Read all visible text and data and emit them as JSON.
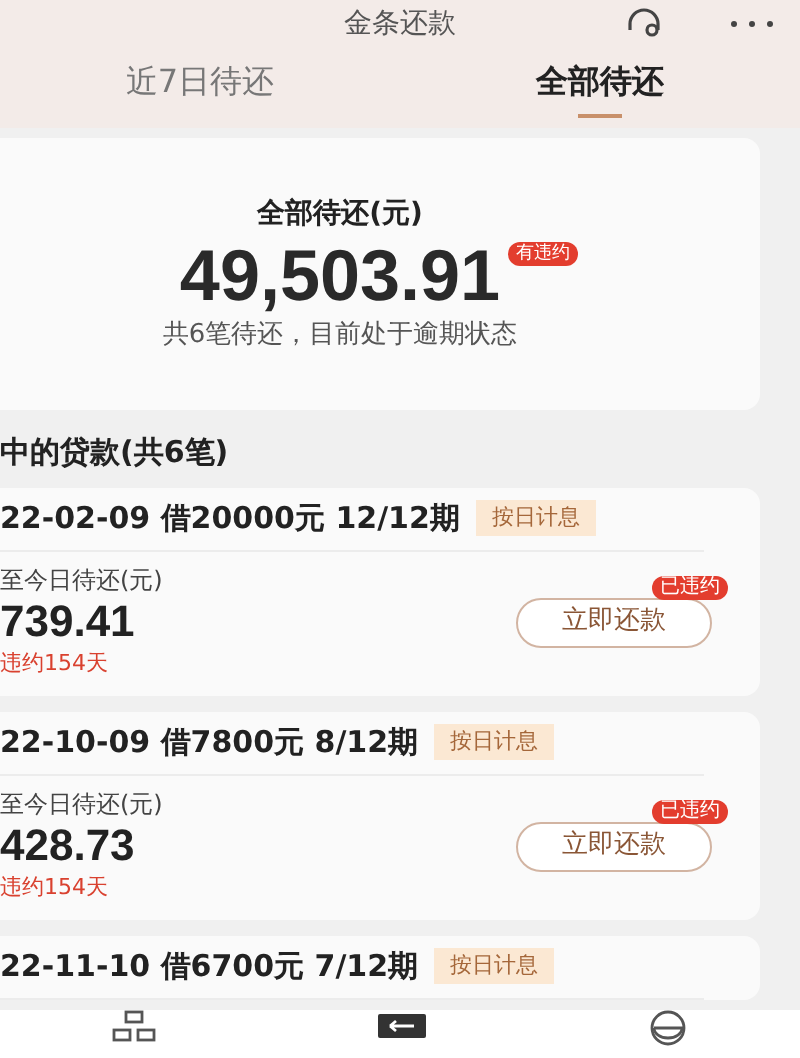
{
  "header": {
    "title": "金条还款"
  },
  "tabs": [
    {
      "label": "近7日待还",
      "selected": false
    },
    {
      "label": "全部待还",
      "selected": true
    }
  ],
  "summary": {
    "label": "全部待还(元)",
    "amount": "49,503.91",
    "badge": "有违约",
    "note": "共6笔待还，目前处于逾期状态"
  },
  "section_title": "中的贷款(共6笔)",
  "loans": [
    {
      "title": "22-02-09 借20000元 12/12期",
      "tag": "按日计息",
      "label": "至今日待还(元)",
      "amount": "739.41",
      "overdue": "违约154天",
      "button": "立即还款",
      "badge": "已违约"
    },
    {
      "title": "22-10-09 借7800元 8/12期",
      "tag": "按日计息",
      "label": "至今日待还(元)",
      "amount": "428.73",
      "overdue": "违约154天",
      "button": "立即还款",
      "badge": "已违约"
    },
    {
      "title": "22-11-10 借6700元 7/12期",
      "tag": "按日计息"
    }
  ]
}
